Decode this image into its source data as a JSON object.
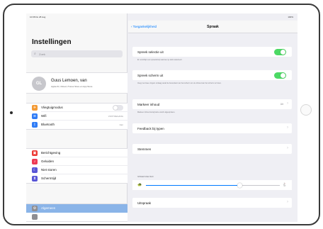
{
  "status_bar": {
    "time": "10:08 Do 28 Aug",
    "battery": "100%"
  },
  "sidebar": {
    "title": "Instellingen",
    "search_placeholder": "Zoek",
    "profile": {
      "initials": "GL",
      "name": "Guus Lemoen, van",
      "subtitle": "Apple ID, iCloud, iTunes Store en App Store"
    },
    "group1": [
      {
        "label": "Vliegtuigmodus",
        "icon": "airplane-icon",
        "color": "#f39a35",
        "toggle": true
      },
      {
        "label": "Wifi",
        "icon": "wifi-icon",
        "color": "#2f7cf6",
        "value": "VOXTOEGANG"
      },
      {
        "label": "Bluetooth",
        "icon": "bluetooth-icon",
        "color": "#2f7cf6",
        "value": "Aan"
      }
    ],
    "group2": [
      {
        "label": "Berichtgeving",
        "icon": "notifications-icon",
        "color": "#ec3b35"
      },
      {
        "label": "Geluiden",
        "icon": "sounds-icon",
        "color": "#ee3a54"
      },
      {
        "label": "Niet storen",
        "icon": "moon-icon",
        "color": "#5855d6"
      },
      {
        "label": "Schermtijd",
        "icon": "hourglass-icon",
        "color": "#5855d6"
      }
    ],
    "group3": [
      {
        "label": "Algemeen",
        "icon": "gear-icon",
        "color": "#8e8e93",
        "selected": true
      }
    ]
  },
  "detail": {
    "back_label": "Toegankelijkheid",
    "title": "Spraak",
    "rows": {
      "speak_selection": {
        "label": "Spreek selectie uit",
        "on": true,
        "footer": "Er verschijnt een spreekknop wanneer je tekst selecteert."
      },
      "speak_screen": {
        "label": "Spreek scherm uit",
        "on": true,
        "footer": "Veeg met twee vingers omlaag vanaf de bovenkant van het scherm om de inhoud van het scherm te horen."
      },
      "highlight": {
        "label": "Markeer inhoud",
        "value": "Uit",
        "footer": "Markeer inhoud terwijl deze wordt uitgesproken."
      },
      "typing_feedback": {
        "label": "Feedback bij typen"
      },
      "voices": {
        "label": "Stemmen"
      },
      "rate_header": "SPREEKSNELHEID",
      "rate_value": 0.7,
      "pronunciations": {
        "label": "Uitspraak"
      }
    }
  }
}
